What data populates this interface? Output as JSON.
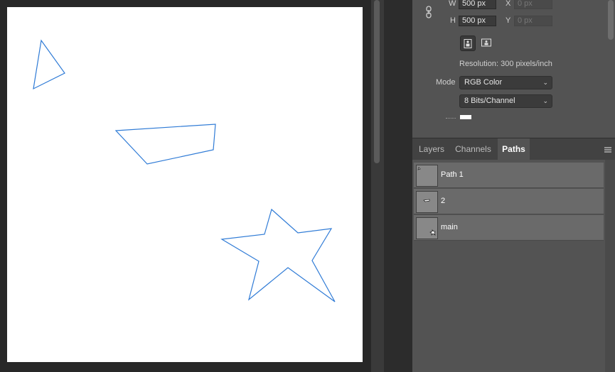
{
  "properties": {
    "width_label": "W",
    "width_value": "500 px",
    "height_label": "H",
    "height_value": "500 px",
    "x_label": "X",
    "x_placeholder": "0 px",
    "y_label": "Y",
    "y_placeholder": "0 px",
    "resolution": "Resolution: 300 pixels/inch",
    "mode_label": "Mode",
    "mode_value": "RGB Color",
    "depth_value": "8 Bits/Channel"
  },
  "tabs": [
    {
      "label": "Layers",
      "active": false
    },
    {
      "label": "Channels",
      "active": false
    },
    {
      "label": "Paths",
      "active": true
    }
  ],
  "paths": [
    {
      "name": "Path 1"
    },
    {
      "name": "2"
    },
    {
      "name": "main"
    }
  ],
  "colors": {
    "path_stroke": "#2f7bd6",
    "active_tab_text": "#ffffff"
  }
}
